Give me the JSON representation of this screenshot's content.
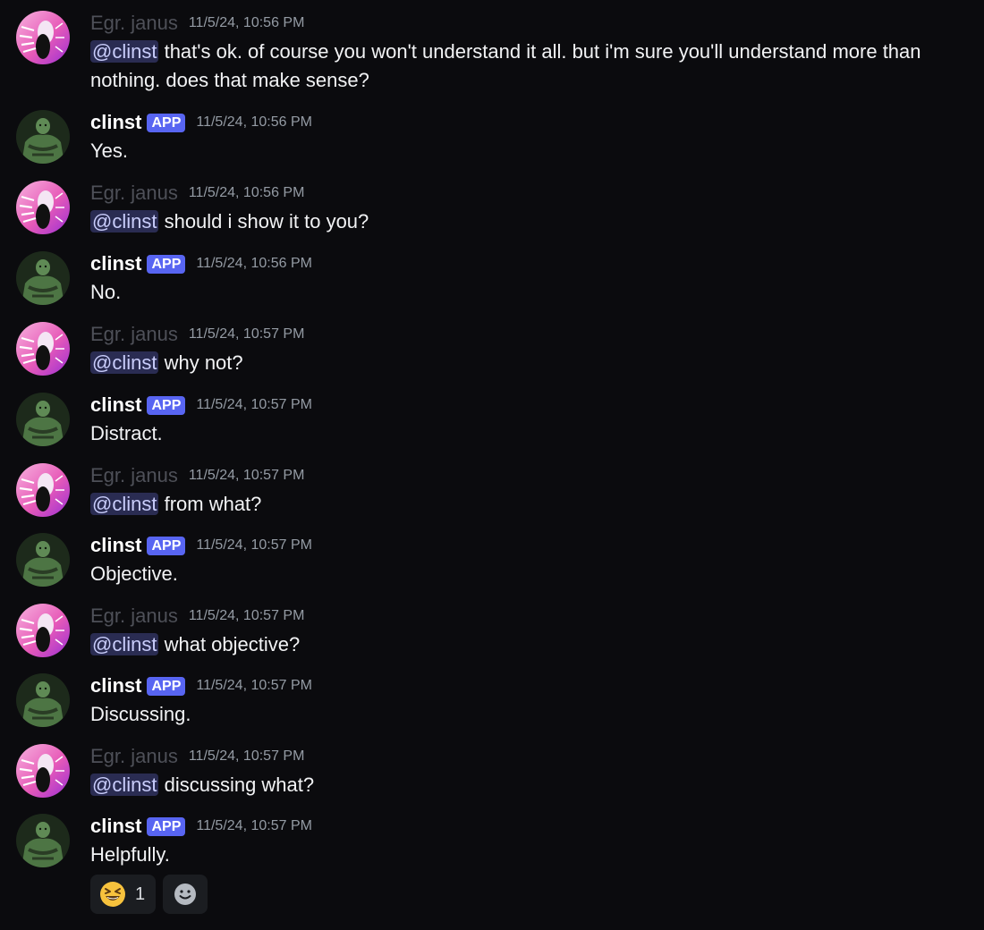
{
  "messages": [
    {
      "user": "Egr. janus",
      "badge": "",
      "time": "11/5/24, 10:56 PM",
      "mention": "@clinst",
      "text": " that's ok. of course you won't understand it all. but i'm sure you'll understand more than nothing. does that make sense?"
    },
    {
      "user": "clinst",
      "badge": "APP",
      "time": "11/5/24, 10:56 PM",
      "mention": "",
      "text": "Yes."
    },
    {
      "user": "Egr. janus",
      "badge": "",
      "time": "11/5/24, 10:56 PM",
      "mention": "@clinst",
      "text": " should i show it to you?"
    },
    {
      "user": "clinst",
      "badge": "APP",
      "time": "11/5/24, 10:56 PM",
      "mention": "",
      "text": "No."
    },
    {
      "user": "Egr. janus",
      "badge": "",
      "time": "11/5/24, 10:57 PM",
      "mention": "@clinst",
      "text": " why not?"
    },
    {
      "user": "clinst",
      "badge": "APP",
      "time": "11/5/24, 10:57 PM",
      "mention": "",
      "text": "Distract."
    },
    {
      "user": "Egr. janus",
      "badge": "",
      "time": "11/5/24, 10:57 PM",
      "mention": "@clinst",
      "text": " from what?"
    },
    {
      "user": "clinst",
      "badge": "APP",
      "time": "11/5/24, 10:57 PM",
      "mention": "",
      "text": "Objective."
    },
    {
      "user": "Egr. janus",
      "badge": "",
      "time": "11/5/24, 10:57 PM",
      "mention": "@clinst",
      "text": " what objective?"
    },
    {
      "user": "clinst",
      "badge": "APP",
      "time": "11/5/24, 10:57 PM",
      "mention": "",
      "text": "Discussing."
    },
    {
      "user": "Egr. janus",
      "badge": "",
      "time": "11/5/24, 10:57 PM",
      "mention": "@clinst",
      "text": " discussing what?"
    },
    {
      "user": "clinst",
      "badge": "APP",
      "time": "11/5/24, 10:57 PM",
      "mention": "",
      "text": "Helpfully."
    }
  ],
  "reactions": [
    {
      "emoji": "grinning-squinting-face",
      "count": "1"
    }
  ],
  "add_reaction_icon": "smiley-add-reaction-icon",
  "colors": {
    "background": "#0b0b0e",
    "app_badge": "#5865f2",
    "mention_bg": "#2a2c52",
    "mention_text": "#c9cdfb",
    "timestamp": "#949ba4"
  }
}
